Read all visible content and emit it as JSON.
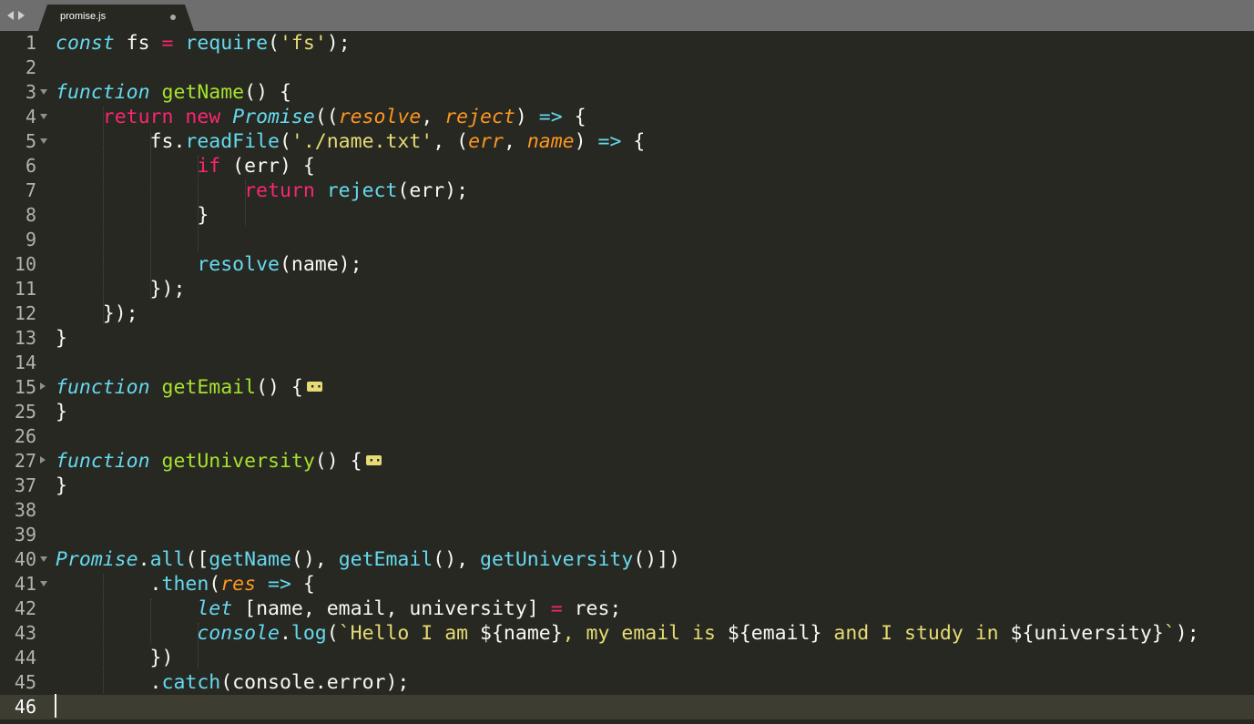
{
  "tab": {
    "title": "promise.js"
  },
  "editor": {
    "lines": [
      {
        "n": "1",
        "fold": ""
      },
      {
        "n": "2",
        "fold": ""
      },
      {
        "n": "3",
        "fold": "open"
      },
      {
        "n": "4",
        "fold": "open"
      },
      {
        "n": "5",
        "fold": "open"
      },
      {
        "n": "6",
        "fold": ""
      },
      {
        "n": "7",
        "fold": ""
      },
      {
        "n": "8",
        "fold": ""
      },
      {
        "n": "9",
        "fold": ""
      },
      {
        "n": "10",
        "fold": ""
      },
      {
        "n": "11",
        "fold": ""
      },
      {
        "n": "12",
        "fold": ""
      },
      {
        "n": "13",
        "fold": ""
      },
      {
        "n": "14",
        "fold": ""
      },
      {
        "n": "15",
        "fold": "closed"
      },
      {
        "n": "25",
        "fold": ""
      },
      {
        "n": "26",
        "fold": ""
      },
      {
        "n": "27",
        "fold": "closed"
      },
      {
        "n": "37",
        "fold": ""
      },
      {
        "n": "38",
        "fold": ""
      },
      {
        "n": "39",
        "fold": ""
      },
      {
        "n": "40",
        "fold": "open"
      },
      {
        "n": "41",
        "fold": "open"
      },
      {
        "n": "42",
        "fold": ""
      },
      {
        "n": "43",
        "fold": ""
      },
      {
        "n": "44",
        "fold": ""
      },
      {
        "n": "45",
        "fold": ""
      },
      {
        "n": "46",
        "fold": ""
      }
    ],
    "active_line": "46"
  }
}
